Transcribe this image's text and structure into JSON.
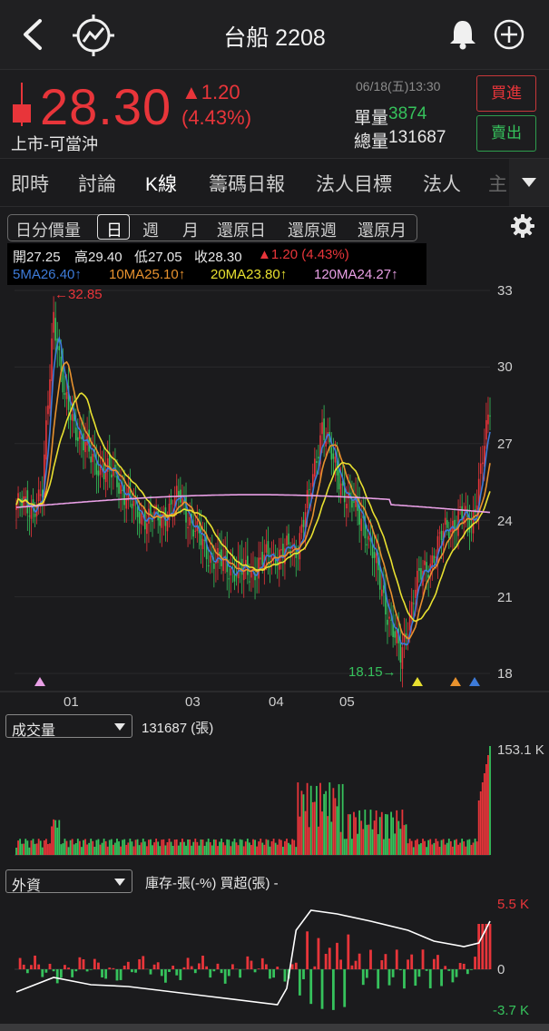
{
  "header": {
    "title": "台船 2208"
  },
  "quote": {
    "price": "28.30",
    "change": "▲1.20",
    "change_pct": "(4.43%)",
    "market_label": "上市-可當沖",
    "datetime": "06/18(五)13:30",
    "single_vol_label": "單量",
    "single_vol": "3874",
    "total_vol_label": "總量",
    "total_vol": "131687",
    "buy_label": "買進",
    "sell_label": "賣出"
  },
  "tabs": [
    "即時",
    "討論",
    "K線",
    "籌碼日報",
    "法人目標",
    "法人",
    "主"
  ],
  "period": {
    "items": [
      "日分價量",
      "日",
      "週",
      "月",
      "還原日",
      "還原週",
      "還原月"
    ],
    "selected": "日"
  },
  "ohlc": {
    "open": "開27.25",
    "high": "高29.40",
    "low": "低27.05",
    "close": "收28.30",
    "change": "▲1.20 (4.43%)"
  },
  "ma": {
    "ma5": "5MA26.40↑",
    "ma10": "10MA25.10↑",
    "ma20": "20MA23.80↑",
    "ma120": "120MA24.27↑"
  },
  "colors": {
    "up": "#e8353a",
    "down": "#36c25c",
    "ma5": "#3d7bd9",
    "ma10": "#e8922e",
    "ma20": "#e8e030",
    "ma120": "#e9a0e6",
    "line": "#ffffff"
  },
  "kline": {
    "y_ticks": [
      "33",
      "30",
      "27",
      "24",
      "21",
      "18"
    ],
    "x_ticks": [
      "01",
      "03",
      "04",
      "05"
    ],
    "max_annot": "←32.85",
    "min_annot": "18.15→"
  },
  "volume": {
    "selector": "成交量",
    "value": "131687 (張)",
    "max_label": "153.1 K"
  },
  "foreign": {
    "selector": "外資",
    "info": "庫存-張(-%)  買超(張) -",
    "max_label": "5.5 K",
    "zero_label": "0",
    "min_label": "-3.7 K"
  },
  "chart_data": {
    "type": "candlestick",
    "ylim": [
      18,
      33
    ],
    "x_ticks": [
      "01",
      "03",
      "04",
      "05"
    ],
    "y_ticks": [
      33,
      30,
      27,
      24,
      21,
      18
    ],
    "high": 32.85,
    "low": 18.15,
    "last": {
      "open": 27.25,
      "high": 29.4,
      "low": 27.05,
      "close": 28.3
    },
    "ma": {
      "5MA": 26.4,
      "10MA": 25.1,
      "20MA": 23.8,
      "120MA": 24.27
    },
    "volume_max": "153.1 K",
    "foreign_range": [
      "-3.7 K",
      "5.5 K"
    ]
  }
}
